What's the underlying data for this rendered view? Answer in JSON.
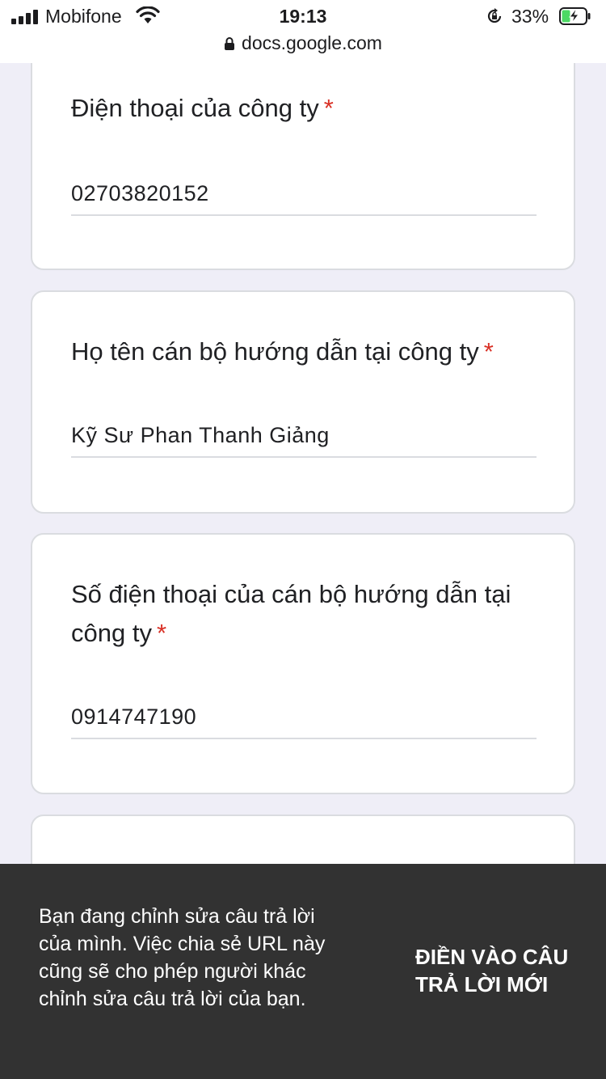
{
  "status_bar": {
    "carrier": "Mobifone",
    "time": "19:13",
    "battery_percent": "33%",
    "signal_icon": "signal-bars-icon",
    "wifi_icon": "wifi-icon",
    "rotation_lock_icon": "rotation-lock-icon",
    "battery_icon": "battery-charging-icon"
  },
  "address_bar": {
    "domain": "docs.google.com",
    "lock_icon": "padlock-icon"
  },
  "form": {
    "questions": [
      {
        "title": "Điện thoại của công ty",
        "required_mark": "*",
        "answer": "02703820152"
      },
      {
        "title": "Họ tên cán bộ hướng dẫn tại công ty",
        "required_mark": "*",
        "answer": "Kỹ Sư Phan Thanh Giảng"
      },
      {
        "title": "Số điện thoại của cán bộ hướng dẫn tại công ty",
        "required_mark": "*",
        "answer": "0914747190"
      }
    ]
  },
  "snackbar": {
    "message": "Bạn đang chỉnh sửa câu trả lời của mình. Việc chia sẻ URL này cũng sẽ cho phép người khác chỉnh sửa câu trả lời của bạn.",
    "action_label": "ĐIỀN VÀO CÂU TRẢ LỜI MỚI"
  },
  "colors": {
    "page_background": "#efeef7",
    "required_asterisk": "#d93025",
    "snackbar_background": "#323232"
  }
}
